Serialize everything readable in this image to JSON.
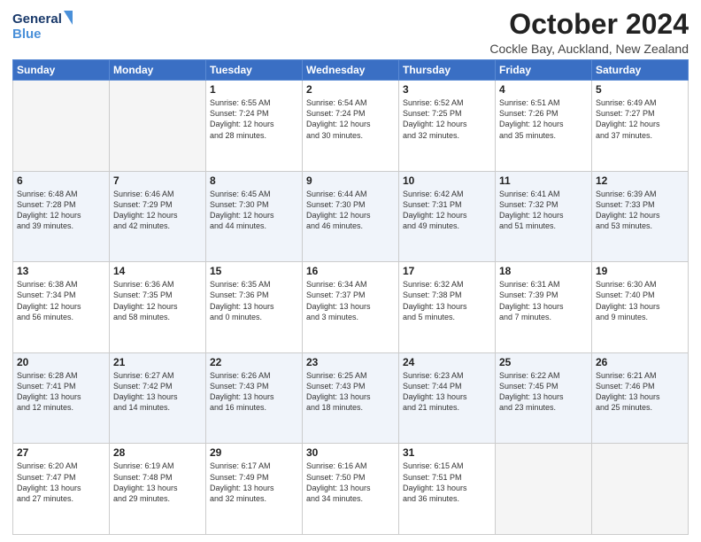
{
  "header": {
    "logo_line1": "General",
    "logo_line2": "Blue",
    "title": "October 2024",
    "location": "Cockle Bay, Auckland, New Zealand"
  },
  "days_of_week": [
    "Sunday",
    "Monday",
    "Tuesday",
    "Wednesday",
    "Thursday",
    "Friday",
    "Saturday"
  ],
  "weeks": [
    [
      {
        "day": "",
        "info": ""
      },
      {
        "day": "",
        "info": ""
      },
      {
        "day": "1",
        "info": "Sunrise: 6:55 AM\nSunset: 7:24 PM\nDaylight: 12 hours\nand 28 minutes."
      },
      {
        "day": "2",
        "info": "Sunrise: 6:54 AM\nSunset: 7:24 PM\nDaylight: 12 hours\nand 30 minutes."
      },
      {
        "day": "3",
        "info": "Sunrise: 6:52 AM\nSunset: 7:25 PM\nDaylight: 12 hours\nand 32 minutes."
      },
      {
        "day": "4",
        "info": "Sunrise: 6:51 AM\nSunset: 7:26 PM\nDaylight: 12 hours\nand 35 minutes."
      },
      {
        "day": "5",
        "info": "Sunrise: 6:49 AM\nSunset: 7:27 PM\nDaylight: 12 hours\nand 37 minutes."
      }
    ],
    [
      {
        "day": "6",
        "info": "Sunrise: 6:48 AM\nSunset: 7:28 PM\nDaylight: 12 hours\nand 39 minutes."
      },
      {
        "day": "7",
        "info": "Sunrise: 6:46 AM\nSunset: 7:29 PM\nDaylight: 12 hours\nand 42 minutes."
      },
      {
        "day": "8",
        "info": "Sunrise: 6:45 AM\nSunset: 7:30 PM\nDaylight: 12 hours\nand 44 minutes."
      },
      {
        "day": "9",
        "info": "Sunrise: 6:44 AM\nSunset: 7:30 PM\nDaylight: 12 hours\nand 46 minutes."
      },
      {
        "day": "10",
        "info": "Sunrise: 6:42 AM\nSunset: 7:31 PM\nDaylight: 12 hours\nand 49 minutes."
      },
      {
        "day": "11",
        "info": "Sunrise: 6:41 AM\nSunset: 7:32 PM\nDaylight: 12 hours\nand 51 minutes."
      },
      {
        "day": "12",
        "info": "Sunrise: 6:39 AM\nSunset: 7:33 PM\nDaylight: 12 hours\nand 53 minutes."
      }
    ],
    [
      {
        "day": "13",
        "info": "Sunrise: 6:38 AM\nSunset: 7:34 PM\nDaylight: 12 hours\nand 56 minutes."
      },
      {
        "day": "14",
        "info": "Sunrise: 6:36 AM\nSunset: 7:35 PM\nDaylight: 12 hours\nand 58 minutes."
      },
      {
        "day": "15",
        "info": "Sunrise: 6:35 AM\nSunset: 7:36 PM\nDaylight: 13 hours\nand 0 minutes."
      },
      {
        "day": "16",
        "info": "Sunrise: 6:34 AM\nSunset: 7:37 PM\nDaylight: 13 hours\nand 3 minutes."
      },
      {
        "day": "17",
        "info": "Sunrise: 6:32 AM\nSunset: 7:38 PM\nDaylight: 13 hours\nand 5 minutes."
      },
      {
        "day": "18",
        "info": "Sunrise: 6:31 AM\nSunset: 7:39 PM\nDaylight: 13 hours\nand 7 minutes."
      },
      {
        "day": "19",
        "info": "Sunrise: 6:30 AM\nSunset: 7:40 PM\nDaylight: 13 hours\nand 9 minutes."
      }
    ],
    [
      {
        "day": "20",
        "info": "Sunrise: 6:28 AM\nSunset: 7:41 PM\nDaylight: 13 hours\nand 12 minutes."
      },
      {
        "day": "21",
        "info": "Sunrise: 6:27 AM\nSunset: 7:42 PM\nDaylight: 13 hours\nand 14 minutes."
      },
      {
        "day": "22",
        "info": "Sunrise: 6:26 AM\nSunset: 7:43 PM\nDaylight: 13 hours\nand 16 minutes."
      },
      {
        "day": "23",
        "info": "Sunrise: 6:25 AM\nSunset: 7:43 PM\nDaylight: 13 hours\nand 18 minutes."
      },
      {
        "day": "24",
        "info": "Sunrise: 6:23 AM\nSunset: 7:44 PM\nDaylight: 13 hours\nand 21 minutes."
      },
      {
        "day": "25",
        "info": "Sunrise: 6:22 AM\nSunset: 7:45 PM\nDaylight: 13 hours\nand 23 minutes."
      },
      {
        "day": "26",
        "info": "Sunrise: 6:21 AM\nSunset: 7:46 PM\nDaylight: 13 hours\nand 25 minutes."
      }
    ],
    [
      {
        "day": "27",
        "info": "Sunrise: 6:20 AM\nSunset: 7:47 PM\nDaylight: 13 hours\nand 27 minutes."
      },
      {
        "day": "28",
        "info": "Sunrise: 6:19 AM\nSunset: 7:48 PM\nDaylight: 13 hours\nand 29 minutes."
      },
      {
        "day": "29",
        "info": "Sunrise: 6:17 AM\nSunset: 7:49 PM\nDaylight: 13 hours\nand 32 minutes."
      },
      {
        "day": "30",
        "info": "Sunrise: 6:16 AM\nSunset: 7:50 PM\nDaylight: 13 hours\nand 34 minutes."
      },
      {
        "day": "31",
        "info": "Sunrise: 6:15 AM\nSunset: 7:51 PM\nDaylight: 13 hours\nand 36 minutes."
      },
      {
        "day": "",
        "info": ""
      },
      {
        "day": "",
        "info": ""
      }
    ]
  ]
}
